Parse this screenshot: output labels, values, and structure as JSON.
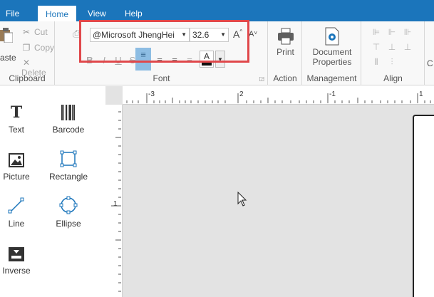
{
  "menubar": {
    "file": "File",
    "home": "Home",
    "view": "View",
    "help": "Help"
  },
  "ribbon": {
    "clipboard": {
      "paste": "aste",
      "cut": "Cut",
      "copy": "Copy",
      "delete": "Delete",
      "label": "Clipboard"
    },
    "font": {
      "family": "@Microsoft JhengHei",
      "size": "32.6",
      "grow": "A",
      "shrink": "A",
      "bold": "B",
      "italic": "I",
      "underline": "U",
      "strike": "S",
      "color_letter": "A",
      "label": "Font"
    },
    "action": {
      "print": "Print",
      "label": "Action"
    },
    "management": {
      "doc_props_line1": "Document",
      "doc_props_line2": "Properties",
      "label": "Management"
    },
    "align": {
      "label": "Align"
    },
    "overflow_letter": "C"
  },
  "toolbox": {
    "text": "Text",
    "barcode": "Barcode",
    "picture": "Picture",
    "rectangle": "Rectangle",
    "line": "Line",
    "ellipse": "Ellipse",
    "inverse": "Inverse"
  },
  "ruler": {
    "h_minus3": "-3",
    "h_2": "2",
    "h_minus1": "-1",
    "h_1": "1",
    "v_1": "1"
  },
  "colors": {
    "accent": "#1b75bb",
    "highlight": "#e0484b",
    "selected": "#8dbde3"
  }
}
